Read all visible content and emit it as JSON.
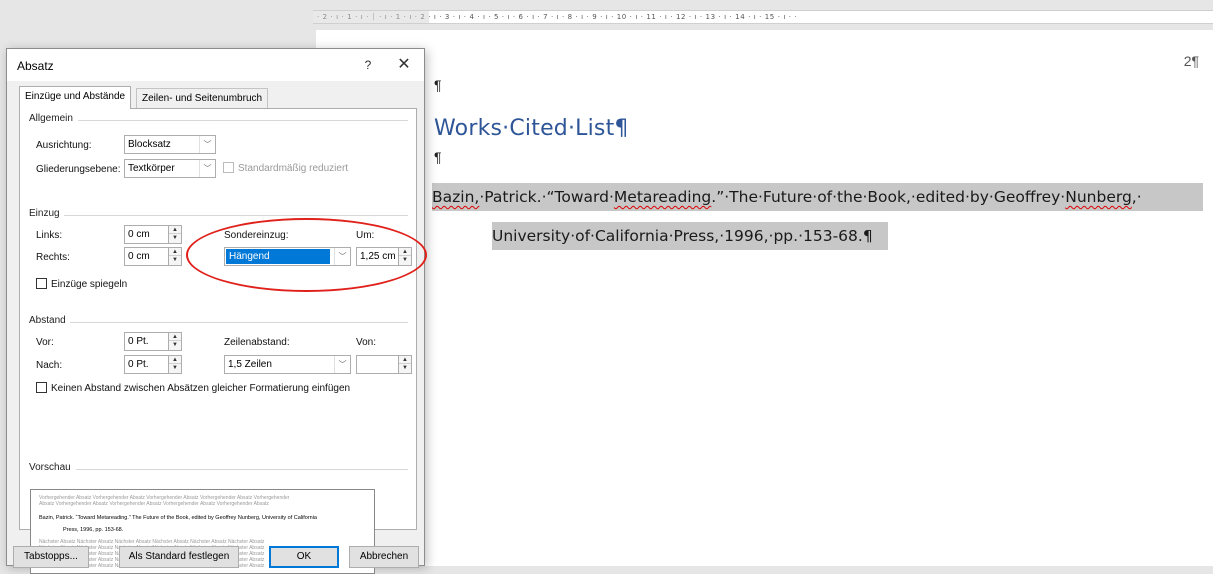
{
  "ruler": {
    "labels": "· 2 · ı · 1 · ı · ⏐ · ı · 1 · ı · 2 · ı · 3 · ı · 4 · ı · 5 · ı · 6 · ı · 7 · ı · 8 · ı · 9 · ı · 10 · ı · 11 · ı · 12 · ı · 13 · ı · 14 · ı · 15 · ı · ·"
  },
  "document": {
    "page_number": "2¶",
    "pilcrow": "¶",
    "title": "Works·Cited·List¶",
    "citation_line1_a": "Bazin,",
    "citation_line1_b": "·Patrick.·“Toward·",
    "citation_line1_c": "Metareading",
    "citation_line1_d": ".”·The·Future·of·the·Book,·edited·by·Geoffrey·",
    "citation_line1_e": "Nunberg",
    "citation_line1_f": ",·",
    "citation_line2": "University·of·California·Press,·1996,·pp.·153-68.¶"
  },
  "dialog": {
    "title": "Absatz",
    "help": "?",
    "close": "✕",
    "tabs": [
      "Einzüge und Abstände",
      "Zeilen- und Seitenumbruch"
    ],
    "allgemein": {
      "section": "Allgemein",
      "ausrichtung_label": "Ausrichtung:",
      "ausrichtung_value": "Blocksatz",
      "gliederung_label": "Gliederungsebene:",
      "gliederung_value": "Textkörper",
      "standard_reduziert": "Standardmäßig reduziert"
    },
    "einzug": {
      "section": "Einzug",
      "links_label": "Links:",
      "links_value": "0 cm",
      "rechts_label": "Rechts:",
      "rechts_value": "0 cm",
      "sonder_label": "Sondereinzug:",
      "sonder_value": "Hängend",
      "um_label": "Um:",
      "um_value": "1,25 cm",
      "spiegeln": "Einzüge spiegeln"
    },
    "abstand": {
      "section": "Abstand",
      "vor_label": "Vor:",
      "vor_value": "0 Pt.",
      "nach_label": "Nach:",
      "nach_value": "0 Pt.",
      "zeilen_label": "Zeilenabstand:",
      "zeilen_value": "1,5 Zeilen",
      "von_label": "Von:",
      "von_value": "",
      "keinen_abstand": "Keinen Abstand zwischen Absätzen gleicher Formatierung einfügen"
    },
    "vorschau": {
      "section": "Vorschau",
      "prev1": "Vorhergehender Absatz Vorhergehender Absatz Vorhergehender Absatz Vorhergehender Absatz Vorhergehender",
      "prev2": "Absatz Vorhergehender Absatz Vorhergehender Absatz Vorhergehender Absatz Vorhergehender Absatz",
      "main1": "Bazin, Patrick. “Toward Metareading.” The Future of the Book, edited by Geoffrey Nunberg, University of California",
      "main2": "Press, 1996, pp. 153-68.",
      "next": "Nächster Absatz Nächster Absatz Nächster Absatz Nächster Absatz Nächster Absatz Nächster Absatz"
    },
    "buttons": {
      "tabstopps": "Tabstopps...",
      "standard": "Als Standard festlegen",
      "ok": "OK",
      "abbrechen": "Abbrechen"
    }
  }
}
